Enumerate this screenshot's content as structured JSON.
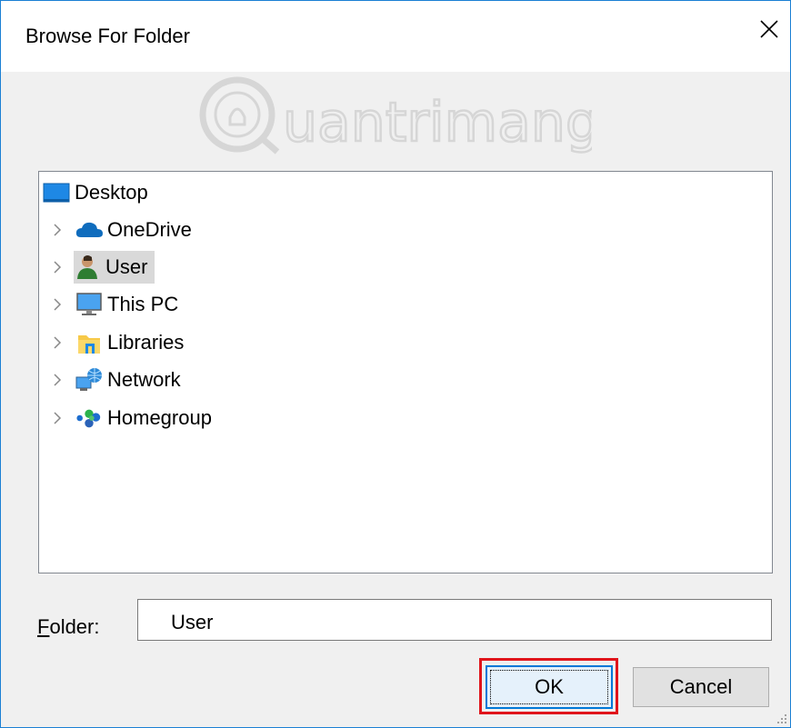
{
  "window": {
    "title": "Browse For Folder",
    "close_icon": "close-icon"
  },
  "watermark": {
    "text": "uantrimang",
    "icon": "lightbulb-q-logo"
  },
  "tree": {
    "root": {
      "label": "Desktop",
      "icon": "desktop-icon"
    },
    "items": [
      {
        "label": "OneDrive",
        "icon": "onedrive-icon",
        "selected": false
      },
      {
        "label": "User",
        "icon": "user-icon",
        "selected": true
      },
      {
        "label": "This PC",
        "icon": "this-pc-icon",
        "selected": false
      },
      {
        "label": "Libraries",
        "icon": "libraries-icon",
        "selected": false
      },
      {
        "label": "Network",
        "icon": "network-icon",
        "selected": false
      },
      {
        "label": "Homegroup",
        "icon": "homegroup-icon",
        "selected": false
      }
    ]
  },
  "folder": {
    "label": "Folder:",
    "value": "User"
  },
  "buttons": {
    "ok": "OK",
    "cancel": "Cancel"
  },
  "colors": {
    "accent": "#0078d7",
    "highlight_box": "#e0151b",
    "selection": "#d9d9d9"
  }
}
